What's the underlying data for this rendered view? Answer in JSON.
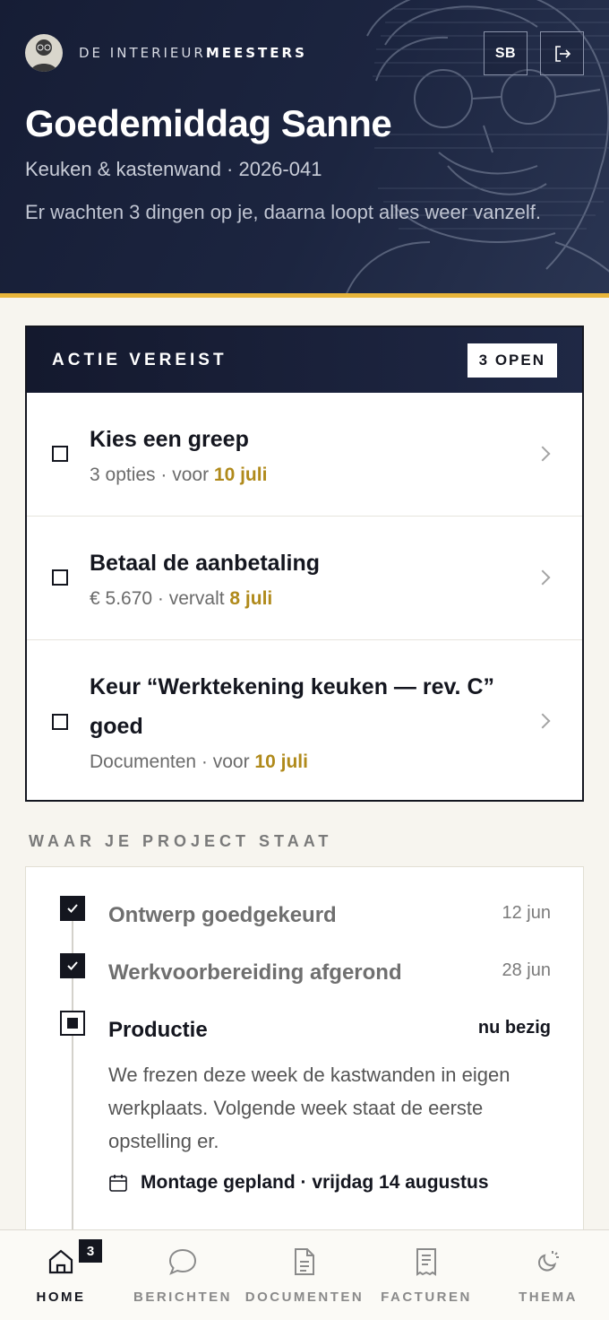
{
  "header": {
    "brand_prefix": "DE INTERIEUR",
    "brand_suffix": "MEESTERS",
    "initials": "SB",
    "greeting": "Goedemiddag Sanne",
    "project": "Keuken & kastenwand · 2026-041",
    "summary": "Er wachten 3 dingen op je, daarna loopt alles weer vanzelf.",
    "colors": {
      "background": "#1a2139",
      "accent": "#e8b53a"
    }
  },
  "actions": {
    "title": "ACTIE VEREIST",
    "badge": "3 OPEN",
    "items": [
      {
        "title": "Kies een greep",
        "meta_prefix": "3 opties · voor ",
        "date": "10 juli"
      },
      {
        "title": "Betaal de aanbetaling",
        "meta_prefix": "€ 5.670 · vervalt ",
        "date": "8 juli"
      },
      {
        "title": "Keur “Werktekening keuken — rev. C” goed",
        "meta_prefix": "Documenten · voor ",
        "date": "10 juli"
      }
    ]
  },
  "progress": {
    "label": "WAAR JE PROJECT STAAT",
    "steps": [
      {
        "title": "Ontwerp goedgekeurd",
        "date": "12 jun",
        "status": "done"
      },
      {
        "title": "Werkvoorbereiding afgerond",
        "date": "28 jun",
        "status": "done"
      },
      {
        "title": "Productie",
        "date": "nu bezig",
        "status": "current"
      }
    ],
    "current_description": "We frezen deze week de kastwanden in eigen werkplaats. Volgende week staat de eerste opstelling er.",
    "montage": "Montage gepland · vrijdag 14 augustus"
  },
  "nav": {
    "items": [
      {
        "label": "HOME",
        "icon": "home-icon",
        "badge": "3"
      },
      {
        "label": "BERICHTEN",
        "icon": "chat-icon"
      },
      {
        "label": "DOCUMENTEN",
        "icon": "document-icon"
      },
      {
        "label": "FACTUREN",
        "icon": "receipt-icon"
      },
      {
        "label": "THEMA",
        "icon": "theme-icon"
      }
    ]
  }
}
